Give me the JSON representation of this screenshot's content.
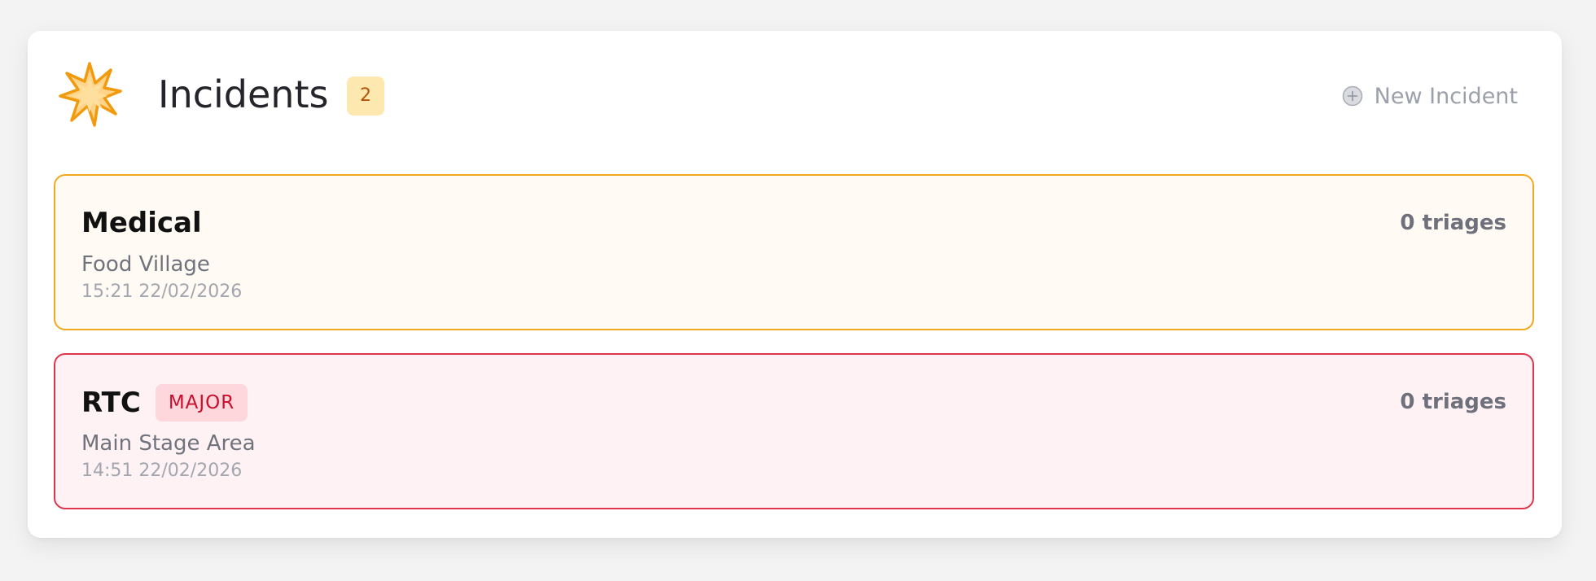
{
  "header": {
    "title": "Incidents",
    "count": "2",
    "icon": "explosion-icon",
    "new_button_label": "New Incident",
    "new_button_icon": "plus-circle-icon"
  },
  "incidents": [
    {
      "type": "Medical",
      "location": "Food Village",
      "time": "15:21 22/02/2026",
      "triages": "0 triages",
      "tag": "",
      "border_color": "#f0a91e",
      "background_color": "#fffaf3"
    },
    {
      "type": "RTC",
      "location": "Main Stage Area",
      "time": "14:51 22/02/2026",
      "triages": "0 triages",
      "tag": "MAJOR",
      "border_color": "#e0334c",
      "background_color": "#fef2f4"
    }
  ],
  "colors": {
    "badge_bg": "#fde9b0",
    "badge_text": "#b45309",
    "major_tag_bg": "#fdd7dc",
    "major_tag_text": "#c8102e"
  }
}
